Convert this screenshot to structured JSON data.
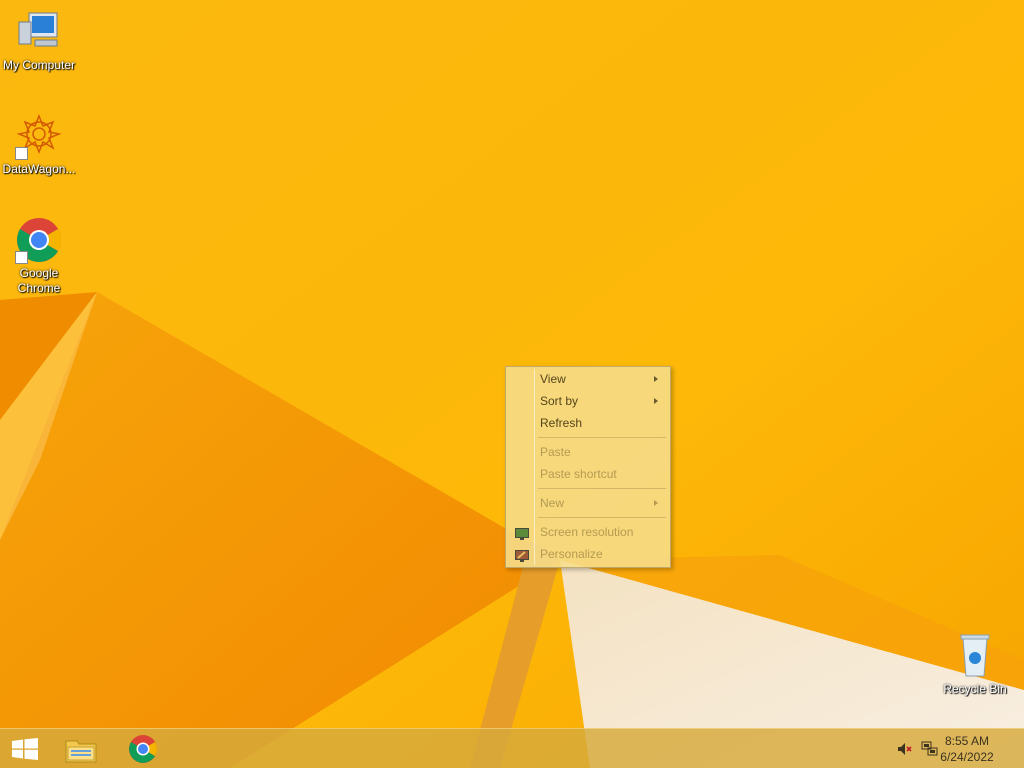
{
  "desktop": {
    "icons": [
      {
        "label": "My Computer",
        "icon": "computer-icon"
      },
      {
        "label": "DataWagon...",
        "icon": "datawagon-icon"
      },
      {
        "label": "Google Chrome",
        "icon": "chrome-icon"
      },
      {
        "label": "Recycle Bin",
        "icon": "recycle-bin-icon"
      }
    ]
  },
  "context_menu": {
    "items": [
      {
        "label": "View",
        "has_submenu": true,
        "enabled": true
      },
      {
        "label": "Sort by",
        "has_submenu": true,
        "enabled": true
      },
      {
        "label": "Refresh",
        "enabled": true
      },
      {
        "label": "Paste",
        "enabled": false
      },
      {
        "label": "Paste shortcut",
        "enabled": false
      },
      {
        "label": "New",
        "has_submenu": true,
        "enabled": false
      },
      {
        "label": "Screen resolution",
        "icon": "display-icon",
        "enabled": false
      },
      {
        "label": "Personalize",
        "icon": "personalize-icon",
        "enabled": false
      }
    ]
  },
  "taskbar": {
    "pinned": [
      {
        "icon": "windows-logo-icon",
        "label": "Start"
      },
      {
        "icon": "file-explorer-icon",
        "label": "File Explorer"
      },
      {
        "icon": "chrome-icon",
        "label": "Google Chrome"
      }
    ],
    "tray": {
      "icons": [
        "volume-muted-icon",
        "network-icon"
      ],
      "time": "8:55 AM",
      "date": "6/24/2022"
    }
  },
  "colors": {
    "wallpaper_base": "#fbb50a",
    "wallpaper_dark": "#f08a00",
    "wallpaper_light": "#f5e7cf",
    "menu_bg": "#f6dd8c",
    "taskbar_bg": "#d6aa3c"
  }
}
